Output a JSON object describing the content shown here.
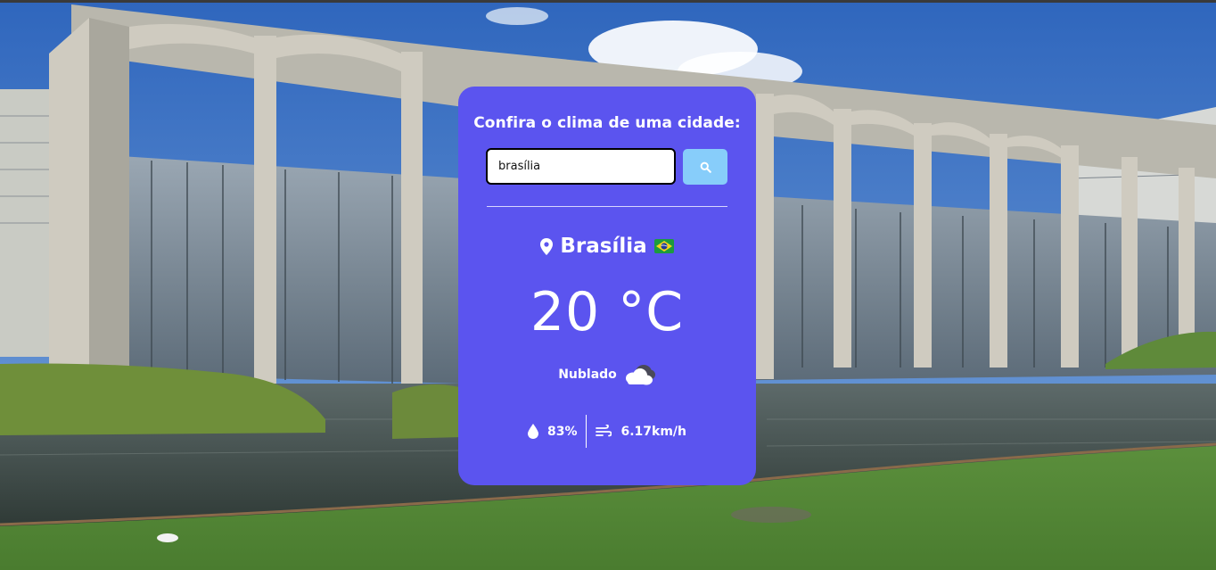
{
  "colors": {
    "card": "#5b54ef",
    "search_button": "#87cdfa",
    "text": "#ffffff",
    "sky": "#3f78c8"
  },
  "weather_card": {
    "title": "Confira o clima de uma cidade:",
    "search": {
      "value": "brasília",
      "placeholder": "",
      "button_icon": "search-icon"
    },
    "city": {
      "icon": "location-pin-icon",
      "name": "Brasília",
      "flag_icon": "brazil-flag-icon"
    },
    "temperature": "20 °C",
    "condition": {
      "label": "Nublado",
      "icon": "cloudy-icon"
    },
    "humidity": {
      "icon": "water-drop-icon",
      "value": "83%"
    },
    "wind": {
      "icon": "wind-icon",
      "value": "6.17km/h"
    }
  }
}
